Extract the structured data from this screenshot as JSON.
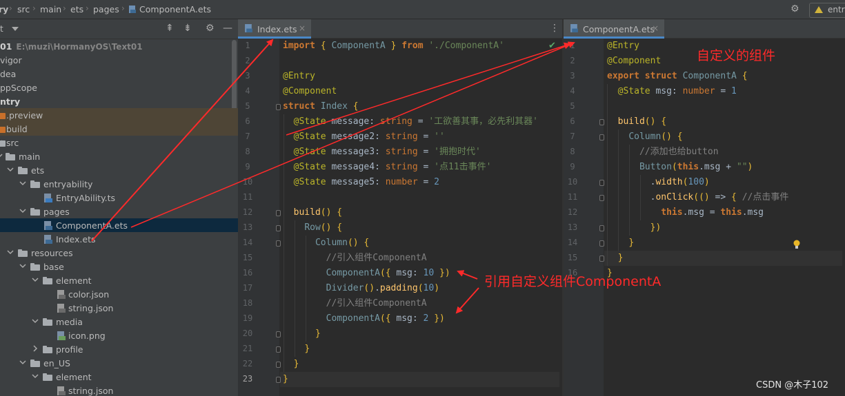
{
  "breadcrumb": [
    "ry",
    "src",
    "main",
    "ets",
    "pages",
    "ComponentA.ets"
  ],
  "run_config": "entr",
  "project_panel": {
    "header": "t",
    "tree": [
      {
        "label": "01",
        "extra": "E:\\muzi\\HormanyOS\\Text01",
        "bold": true
      },
      {
        "label": "vigor"
      },
      {
        "label": "dea"
      },
      {
        "label": "ppScope"
      },
      {
        "label": "ntry",
        "bold": true
      },
      {
        "label": ".preview"
      },
      {
        "label": "build"
      },
      {
        "label": "src"
      },
      {
        "label": "main"
      },
      {
        "label": "ets"
      },
      {
        "label": "entryability"
      },
      {
        "label": "EntryAbility.ts"
      },
      {
        "label": "pages"
      },
      {
        "label": "ComponentA.ets"
      },
      {
        "label": "Index.ets"
      },
      {
        "label": "resources"
      },
      {
        "label": "base"
      },
      {
        "label": "element"
      },
      {
        "label": "color.json"
      },
      {
        "label": "string.json"
      },
      {
        "label": "media"
      },
      {
        "label": "icon.png"
      },
      {
        "label": "profile"
      },
      {
        "label": "en_US"
      },
      {
        "label": "element"
      },
      {
        "label": "string.json"
      }
    ]
  },
  "editor_left": {
    "tab": "Index.ets",
    "close": "×",
    "lines": [
      "import { ComponentA } from './ComponentA'",
      "",
      "@Entry",
      "@Component",
      "struct Index {",
      "  @State message: string = '工欲善其事，必先利其器'",
      "  @State message2: string = ''",
      "  @State message3: string = '拥抱时代'",
      "  @State message4: string = '点11击事件'",
      "  @State message5: number = 2",
      "",
      "  build() {",
      "    Row() {",
      "      Column() {",
      "        //引入组件ComponentA",
      "        ComponentA({ msg: 10 })",
      "        Divider().padding(10)",
      "        //引入组件ComponentA",
      "        ComponentA({ msg: 2 })",
      "      }",
      "    }",
      "  }",
      "}"
    ]
  },
  "editor_right": {
    "tab": "ComponentA.ets",
    "close": "×",
    "lines": [
      "@Entry",
      "@Component",
      "export struct ComponentA {",
      "  @State msg: number = 1",
      "",
      "  build() {",
      "    Column() {",
      "      //添加也给button",
      "      Button(this.msg + \"\")",
      "        .width(100)",
      "        .onClick(() => { //点击事件",
      "          this.msg = this.msg",
      "        })",
      "    }",
      "  }",
      "}"
    ]
  },
  "annotations": {
    "custom_component": "自定义的组件",
    "reference_component": "引用自定义组件ComponentA"
  },
  "watermark": "CSDN @木子102",
  "colors": {
    "annotation": "#ff2a2a",
    "selection": "#0d293e",
    "tab_underline": "#4a88c7"
  }
}
